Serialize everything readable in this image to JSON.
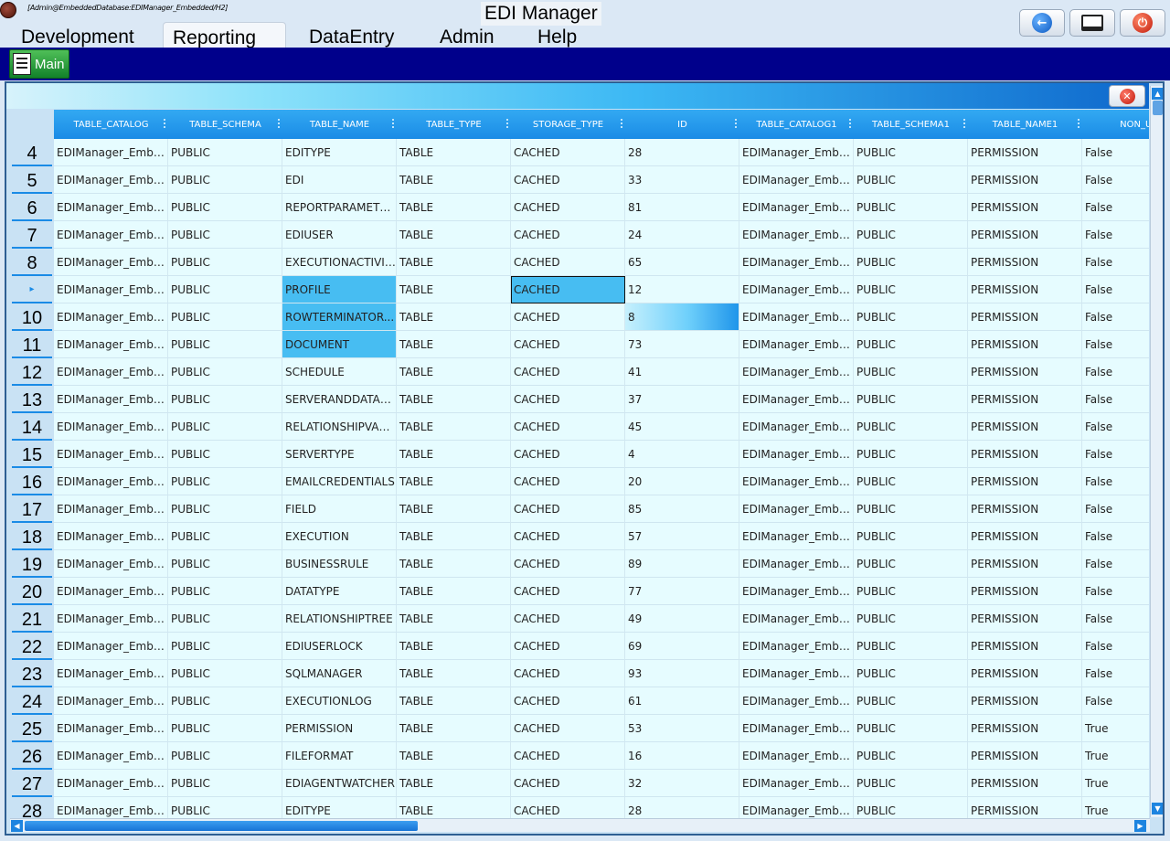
{
  "app": {
    "connection_string": "[Admin@EmbeddedDatabase:EDIManager_Embedded/H2]",
    "title": "EDI Manager"
  },
  "menu": {
    "items": [
      {
        "label": "Development"
      },
      {
        "label": "Reporting"
      },
      {
        "label": "DataEntry"
      },
      {
        "label": "Admin"
      },
      {
        "label": "Help"
      }
    ],
    "active": "Reporting"
  },
  "window_buttons": [
    {
      "icon": "back-arrow-icon"
    },
    {
      "icon": "monitor-icon"
    },
    {
      "icon": "power-icon"
    }
  ],
  "toolbar": {
    "main_label": "Main",
    "main_icon": "document-icon"
  },
  "panel": {
    "close_icon": "close-icon",
    "accent_color": "#1a8be6"
  },
  "grid": {
    "columns": [
      "TABLE_CATALOG",
      "TABLE_SCHEMA",
      "TABLE_NAME",
      "TABLE_TYPE",
      "STORAGE_TYPE",
      "ID",
      "TABLE_CATALOG1",
      "TABLE_SCHEMA1",
      "TABLE_NAME1",
      "NON_UN"
    ],
    "rows": [
      {
        "num": "4",
        "cells": [
          "EDIManager_Embe...",
          "PUBLIC",
          "EDITYPE",
          "TABLE",
          "CACHED",
          "28",
          "EDIManager_Embe...",
          "PUBLIC",
          "PERMISSION",
          "False"
        ]
      },
      {
        "num": "5",
        "cells": [
          "EDIManager_Embe...",
          "PUBLIC",
          "EDI",
          "TABLE",
          "CACHED",
          "33",
          "EDIManager_Embe...",
          "PUBLIC",
          "PERMISSION",
          "False"
        ]
      },
      {
        "num": "6",
        "cells": [
          "EDIManager_Embe...",
          "PUBLIC",
          "REPORTPARAMETE...",
          "TABLE",
          "CACHED",
          "81",
          "EDIManager_Embe...",
          "PUBLIC",
          "PERMISSION",
          "False"
        ]
      },
      {
        "num": "7",
        "cells": [
          "EDIManager_Embe...",
          "PUBLIC",
          "EDIUSER",
          "TABLE",
          "CACHED",
          "24",
          "EDIManager_Embe...",
          "PUBLIC",
          "PERMISSION",
          "False"
        ]
      },
      {
        "num": "8",
        "cells": [
          "EDIManager_Embe...",
          "PUBLIC",
          "EXECUTIONACTIVITY",
          "TABLE",
          "CACHED",
          "65",
          "EDIManager_Embe...",
          "PUBLIC",
          "PERMISSION",
          "False"
        ]
      },
      {
        "num": "▸",
        "current": true,
        "cells": [
          "EDIManager_Embe...",
          "PUBLIC",
          "PROFILE",
          "TABLE",
          "CACHED",
          "12",
          "EDIManager_Embe...",
          "PUBLIC",
          "PERMISSION",
          "False"
        ]
      },
      {
        "num": "10",
        "cells": [
          "EDIManager_Embe...",
          "PUBLIC",
          "ROWTERMINATOR...",
          "TABLE",
          "CACHED",
          "8",
          "EDIManager_Embe...",
          "PUBLIC",
          "PERMISSION",
          "False"
        ]
      },
      {
        "num": "11",
        "cells": [
          "EDIManager_Embe...",
          "PUBLIC",
          "DOCUMENT",
          "TABLE",
          "CACHED",
          "73",
          "EDIManager_Embe...",
          "PUBLIC",
          "PERMISSION",
          "False"
        ]
      },
      {
        "num": "12",
        "cells": [
          "EDIManager_Embe...",
          "PUBLIC",
          "SCHEDULE",
          "TABLE",
          "CACHED",
          "41",
          "EDIManager_Embe...",
          "PUBLIC",
          "PERMISSION",
          "False"
        ]
      },
      {
        "num": "13",
        "cells": [
          "EDIManager_Embe...",
          "PUBLIC",
          "SERVERANDDATAB...",
          "TABLE",
          "CACHED",
          "37",
          "EDIManager_Embe...",
          "PUBLIC",
          "PERMISSION",
          "False"
        ]
      },
      {
        "num": "14",
        "cells": [
          "EDIManager_Embe...",
          "PUBLIC",
          "RELATIONSHIPVARI...",
          "TABLE",
          "CACHED",
          "45",
          "EDIManager_Embe...",
          "PUBLIC",
          "PERMISSION",
          "False"
        ]
      },
      {
        "num": "15",
        "cells": [
          "EDIManager_Embe...",
          "PUBLIC",
          "SERVERTYPE",
          "TABLE",
          "CACHED",
          "4",
          "EDIManager_Embe...",
          "PUBLIC",
          "PERMISSION",
          "False"
        ]
      },
      {
        "num": "16",
        "cells": [
          "EDIManager_Embe...",
          "PUBLIC",
          "EMAILCREDENTIALS",
          "TABLE",
          "CACHED",
          "20",
          "EDIManager_Embe...",
          "PUBLIC",
          "PERMISSION",
          "False"
        ]
      },
      {
        "num": "17",
        "cells": [
          "EDIManager_Embe...",
          "PUBLIC",
          "FIELD",
          "TABLE",
          "CACHED",
          "85",
          "EDIManager_Embe...",
          "PUBLIC",
          "PERMISSION",
          "False"
        ]
      },
      {
        "num": "18",
        "cells": [
          "EDIManager_Embe...",
          "PUBLIC",
          "EXECUTION",
          "TABLE",
          "CACHED",
          "57",
          "EDIManager_Embe...",
          "PUBLIC",
          "PERMISSION",
          "False"
        ]
      },
      {
        "num": "19",
        "cells": [
          "EDIManager_Embe...",
          "PUBLIC",
          "BUSINESSRULE",
          "TABLE",
          "CACHED",
          "89",
          "EDIManager_Embe...",
          "PUBLIC",
          "PERMISSION",
          "False"
        ]
      },
      {
        "num": "20",
        "cells": [
          "EDIManager_Embe...",
          "PUBLIC",
          "DATATYPE",
          "TABLE",
          "CACHED",
          "77",
          "EDIManager_Embe...",
          "PUBLIC",
          "PERMISSION",
          "False"
        ]
      },
      {
        "num": "21",
        "cells": [
          "EDIManager_Embe...",
          "PUBLIC",
          "RELATIONSHIPTREE",
          "TABLE",
          "CACHED",
          "49",
          "EDIManager_Embe...",
          "PUBLIC",
          "PERMISSION",
          "False"
        ]
      },
      {
        "num": "22",
        "cells": [
          "EDIManager_Embe...",
          "PUBLIC",
          "EDIUSERLOCK",
          "TABLE",
          "CACHED",
          "69",
          "EDIManager_Embe...",
          "PUBLIC",
          "PERMISSION",
          "False"
        ]
      },
      {
        "num": "23",
        "cells": [
          "EDIManager_Embe...",
          "PUBLIC",
          "SQLMANAGER",
          "TABLE",
          "CACHED",
          "93",
          "EDIManager_Embe...",
          "PUBLIC",
          "PERMISSION",
          "False"
        ]
      },
      {
        "num": "24",
        "cells": [
          "EDIManager_Embe...",
          "PUBLIC",
          "EXECUTIONLOG",
          "TABLE",
          "CACHED",
          "61",
          "EDIManager_Embe...",
          "PUBLIC",
          "PERMISSION",
          "False"
        ]
      },
      {
        "num": "25",
        "cells": [
          "EDIManager_Embe...",
          "PUBLIC",
          "PERMISSION",
          "TABLE",
          "CACHED",
          "53",
          "EDIManager_Embe...",
          "PUBLIC",
          "PERMISSION",
          "True"
        ]
      },
      {
        "num": "26",
        "cells": [
          "EDIManager_Embe...",
          "PUBLIC",
          "FILEFORMAT",
          "TABLE",
          "CACHED",
          "16",
          "EDIManager_Embe...",
          "PUBLIC",
          "PERMISSION",
          "True"
        ]
      },
      {
        "num": "27",
        "cells": [
          "EDIManager_Embe...",
          "PUBLIC",
          "EDIAGENTWATCHER",
          "TABLE",
          "CACHED",
          "32",
          "EDIManager_Embe...",
          "PUBLIC",
          "PERMISSION",
          "True"
        ]
      },
      {
        "num": "28",
        "cells": [
          "EDIManager_Embe...",
          "PUBLIC",
          "EDITYPE",
          "TABLE",
          "CACHED",
          "28",
          "EDIManager_Embe...",
          "PUBLIC",
          "PERMISSION",
          "True"
        ]
      }
    ],
    "selected_cells": [
      {
        "row": 5,
        "col": 2,
        "style": "sel"
      },
      {
        "row": 5,
        "col": 4,
        "style": "sel-focus"
      },
      {
        "row": 6,
        "col": 2,
        "style": "sel"
      },
      {
        "row": 6,
        "col": 5,
        "style": "sel-grad"
      },
      {
        "row": 7,
        "col": 2,
        "style": "sel"
      }
    ]
  }
}
